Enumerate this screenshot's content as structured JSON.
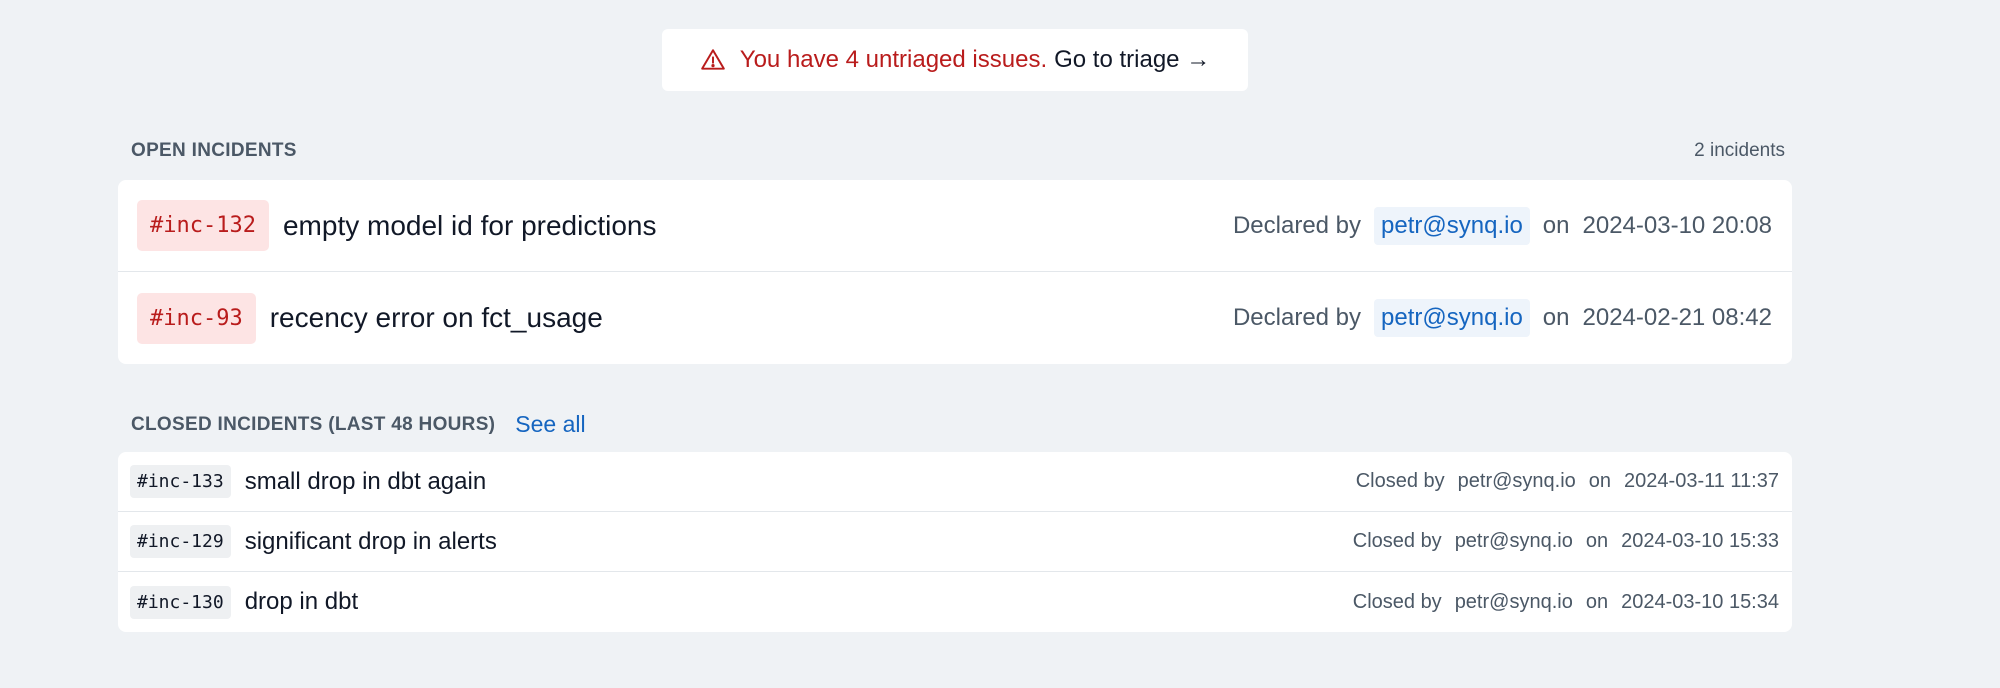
{
  "banner": {
    "message": "You have 4 untriaged issues.",
    "link": "Go to triage →",
    "icon": "warning-triangle-icon",
    "color": "#b91c1c"
  },
  "open_incidents": {
    "heading": "OPEN INCIDENTS",
    "count": "2 incidents",
    "items": [
      {
        "id": "#inc-132",
        "title": "empty model id for predictions",
        "by_label": "Declared by",
        "by": "petr@synq.io",
        "on_label": "on",
        "date": "2024-03-10 20:08"
      },
      {
        "id": "#inc-93",
        "title": "recency error on fct_usage",
        "by_label": "Declared by",
        "by": "petr@synq.io",
        "on_label": "on",
        "date": "2024-02-21 08:42"
      }
    ]
  },
  "closed_incidents": {
    "heading": "CLOSED INCIDENTS (LAST 48 HOURS)",
    "see_all": "See all",
    "items": [
      {
        "id": "#inc-133",
        "title": "small drop in dbt again",
        "by_label": "Closed by",
        "by": "petr@synq.io",
        "on_label": "on",
        "date": "2024-03-11 11:37"
      },
      {
        "id": "#inc-129",
        "title": "significant drop in alerts",
        "by_label": "Closed by",
        "by": "petr@synq.io",
        "on_label": "on",
        "date": "2024-03-10 15:33"
      },
      {
        "id": "#inc-130",
        "title": "drop in dbt",
        "by_label": "Closed by",
        "by": "petr@synq.io",
        "on_label": "on",
        "date": "2024-03-10 15:34"
      }
    ]
  }
}
